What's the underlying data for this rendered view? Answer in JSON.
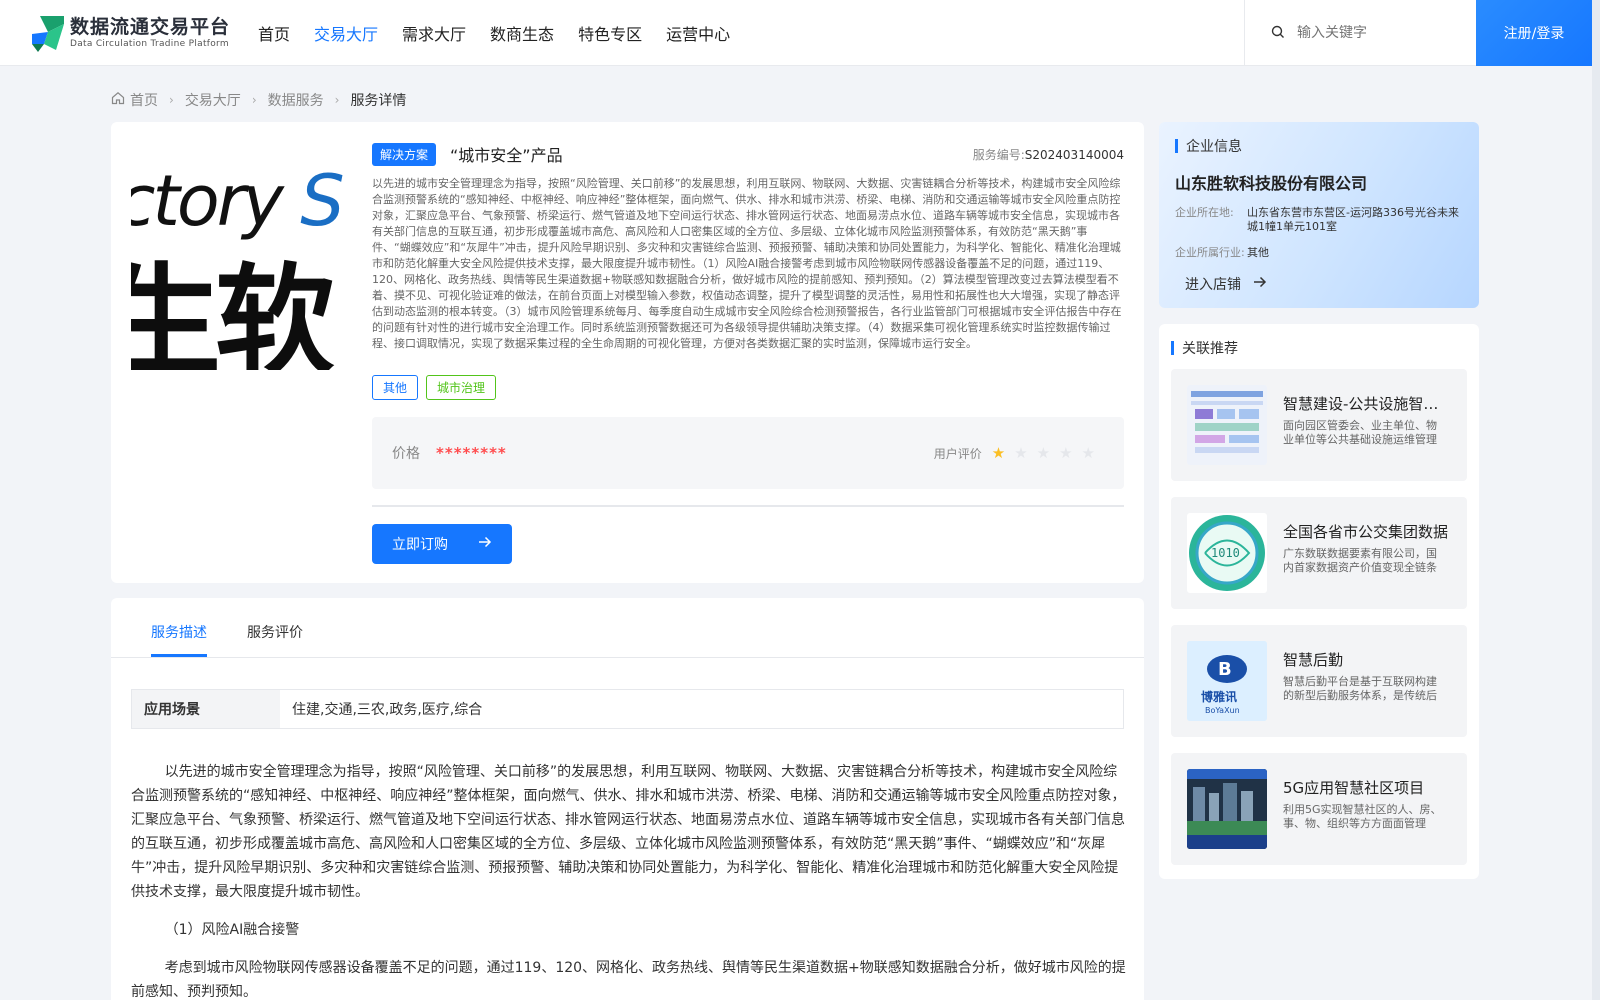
{
  "header": {
    "logo_title": "数据流通交易平台",
    "logo_subtitle": "Data Circulation Tradine Platform",
    "nav": [
      {
        "label": "首页"
      },
      {
        "label": "交易大厅"
      },
      {
        "label": "需求大厅"
      },
      {
        "label": "数商生态"
      },
      {
        "label": "特色专区"
      },
      {
        "label": "运营中心"
      }
    ],
    "active_nav": "交易大厅",
    "search_placeholder": "输入关键字",
    "login_label": "注册/登录"
  },
  "breadcrumb": [
    "首页",
    "交易大厅",
    "数据服务",
    "服务详情"
  ],
  "product": {
    "cover_text_top": "ctory",
    "cover_text_top_accent": "S",
    "cover_text_big": "生软",
    "badge": "解决方案",
    "title": "“城市安全”产品",
    "service_no_label": "服务编号:",
    "service_no": "S202403140004",
    "description": "以先进的城市安全管理理念为指导，按照“风险管理、关口前移”的发展思想，利用互联网、物联网、大数据、灾害链耦合分析等技术，构建城市安全风险综合监测预警系统的“感知神经、中枢神经、响应神经”整体框架，面向燃气、供水、排水和城市洪涝、桥梁、电梯、消防和交通运输等城市安全风险重点防控对象，汇聚应急平台、气象预警、桥梁运行、燃气管道及地下空间运行状态、排水管网运行状态、地面易涝点水位、道路车辆等城市安全信息，实现城市各有关部门信息的互联互通，初步形成覆盖城市高危、高风险和人口密集区域的全方位、多层级、立体化城市风险监测预警体系，有效防范“黑天鹅”事件、“蝴蝶效应”和“灰犀牛”冲击，提升风险早期识别、多灾种和灾害链综合监测、预报预警、辅助决策和协同处置能力，为科学化、智能化、精准化治理城市和防范化解重大安全风险提供技术支撑，最大限度提升城市韧性。（1）风险AI融合接警考虑到城市风险物联网传感器设备覆盖不足的问题，通过119、120、网格化、政务热线、舆情等民生渠道数据+物联感知数据融合分析，做好城市风险的提前感知、预判预知。（2）算法模型管理改变过去算法模型看不着、摸不见、可视化验证难的做法，在前台页面上对模型输入参数，权值动态调整，提升了模型调整的灵活性，易用性和拓展性也大大增强，实现了静态评估到动态监测的根本转变。（3）城市风险管理系统每月、每季度自动生成城市安全风险综合检测预警报告，各行业监管部门可根据城市安全评估报告中存在的问题有针对性的进行城市安全治理工作。同时系统监测预警数据还可为各级领导提供辅助决策支撑。（4）数据采集可视化管理系统实时监控数据传输过程、接口调取情况，实现了数据采集过程的全生命周期的可视化管理，方便对各类数据汇聚的实时监测，保障城市运行安全。",
    "tags": [
      "其他",
      "城市治理"
    ],
    "price_label": "价格",
    "price_value": "********",
    "rating_label": "用户评价",
    "rating": 1,
    "rating_max": 5,
    "buy_label": "立即订购"
  },
  "detail": {
    "tabs": [
      "服务描述",
      "服务评价"
    ],
    "active_tab": "服务描述",
    "scene_key": "应用场景",
    "scene_value": "住建,交通,三农,政务,医疗,综合",
    "paragraph1": "以先进的城市安全管理理念为指导，按照“风险管理、关口前移”的发展思想，利用互联网、物联网、大数据、灾害链耦合分析等技术，构建城市安全风险综合监测预警系统的“感知神经、中枢神经、响应神经”整体框架，面向燃气、供水、排水和城市洪涝、桥梁、电梯、消防和交通运输等城市安全风险重点防控对象，汇聚应急平台、气象预警、桥梁运行、燃气管道及地下空间运行状态、排水管网运行状态、地面易涝点水位、道路车辆等城市安全信息，实现城市各有关部门信息的互联互通，初步形成覆盖城市高危、高风险和人口密集区域的全方位、多层级、立体化城市风险监测预警体系，有效防范“黑天鹅”事件、“蝴蝶效应”和“灰犀牛”冲击，提升风险早期识别、多灾种和灾害链综合监测、预报预警、辅助决策和协同处置能力，为科学化、智能化、精准化治理城市和防范化解重大安全风险提供技术支撑，最大限度提升城市韧性。",
    "subheading1": "（1）风险AI融合接警",
    "paragraph2": "考虑到城市风险物联网传感器设备覆盖不足的问题，通过119、120、网格化、政务热线、舆情等民生渠道数据+物联感知数据融合分析，做好城市风险的提前感知、预判预知。"
  },
  "company": {
    "section_title": "企业信息",
    "name": "山东胜软科技股份有限公司",
    "location_label": "企业所在地:",
    "location": "山东省东营市东营区-运河路336号光谷未来城1幢1单元101室",
    "industry_label": "企业所属行业:",
    "industry": "其他",
    "enter_label": "进入店铺"
  },
  "recommend": {
    "section_title": "关联推荐",
    "items": [
      {
        "title": "智慧建设-公共设施智能化管理",
        "desc": "面向园区管委会、业主单位、物业单位等公共基础设施运维管理部门"
      },
      {
        "title": "全国各省市公交集团数据",
        "desc": "广东数联数据要素有限公司，国内首家数据资产价值变现全链条服务"
      },
      {
        "title": "智慧后勤",
        "desc": "智慧后勤平台是基于互联网构建的新型后勤服务体系，是传统后勤"
      },
      {
        "title": "5G应用智慧社区项目",
        "desc": "利用5G实现智慧社区的人、房、事、物、组织等方方面面管理"
      }
    ]
  }
}
